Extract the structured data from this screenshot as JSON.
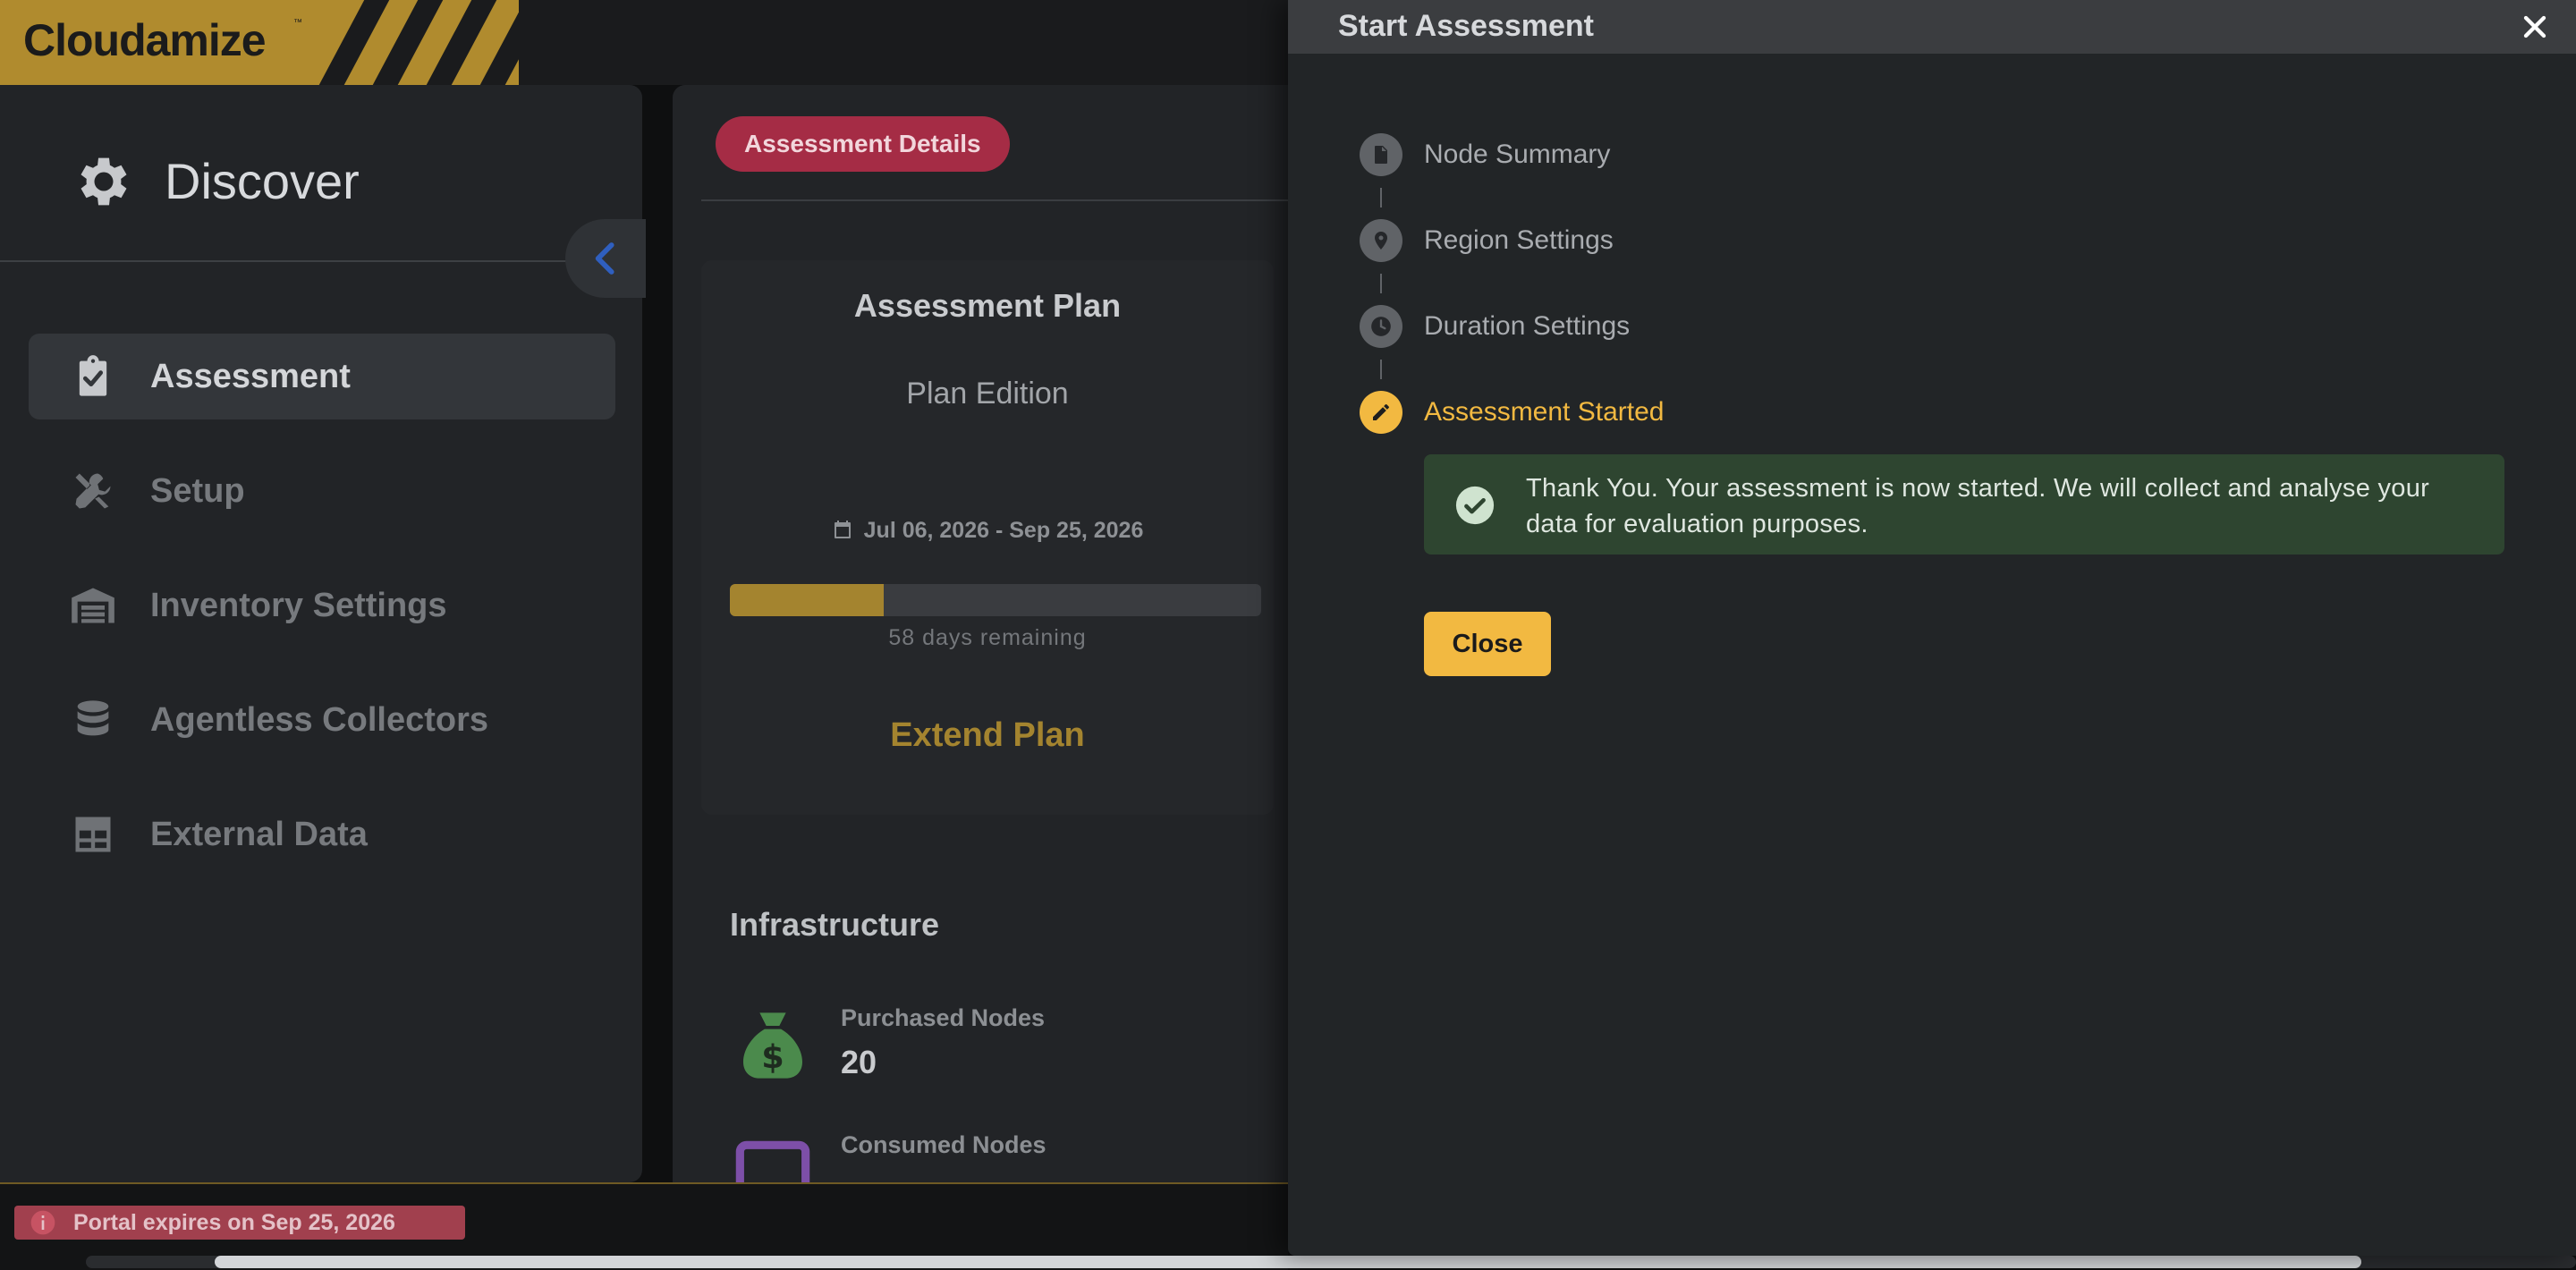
{
  "app": {
    "logo_text": "Cloudamize",
    "logo_tm": "™"
  },
  "sidebar": {
    "title": "Discover",
    "items": [
      {
        "label": "Assessment",
        "icon": "clipboard-check-icon",
        "active": true
      },
      {
        "label": "Setup",
        "icon": "tools-icon"
      },
      {
        "label": "Inventory Settings",
        "icon": "warehouse-icon"
      },
      {
        "label": "Agentless Collectors",
        "icon": "database-icon"
      },
      {
        "label": "External Data",
        "icon": "table-grid-icon"
      }
    ]
  },
  "main": {
    "details_pill": "Assessment Details",
    "plan": {
      "title": "Assessment Plan",
      "edition": "Plan Edition",
      "dates": "Jul 06, 2026 - Sep 25, 2026",
      "progress_percent": 29,
      "days_remaining": "58 days remaining",
      "extend_label": "Extend Plan"
    },
    "infrastructure": {
      "title": "Infrastructure",
      "metrics": [
        {
          "label": "Purchased Nodes",
          "value": "20"
        },
        {
          "label": "Consumed Nodes",
          "value": ""
        }
      ]
    }
  },
  "footer": {
    "expiry_text": "Portal expires on Sep 25, 2026"
  },
  "modal": {
    "title": "Start Assessment",
    "steps": [
      {
        "label": "Node Summary",
        "icon": "document-icon"
      },
      {
        "label": "Region Settings",
        "icon": "map-pin-icon"
      },
      {
        "label": "Duration Settings",
        "icon": "clock-icon"
      },
      {
        "label": "Assessment Started",
        "icon": "pencil-icon",
        "active": true
      }
    ],
    "success_message": "Thank You. Your assessment is now started. We will collect and analyse your data for evaluation purposes.",
    "close_label": "Close"
  },
  "colors": {
    "accent": "#f2b941",
    "brand_gold": "#b08b2e",
    "pill_red": "#a52c45",
    "success_bg": "#2e4530"
  }
}
